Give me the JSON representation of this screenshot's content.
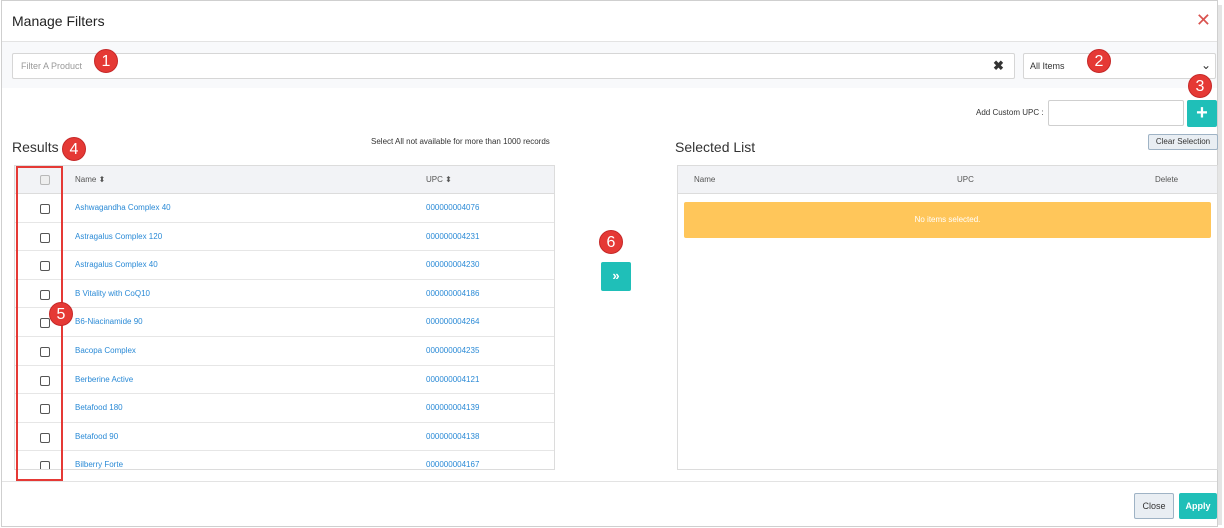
{
  "dialog": {
    "title": "Manage Filters",
    "close_glyph": "✕"
  },
  "filter": {
    "placeholder": "Filter A Product",
    "value": "",
    "clear_glyph": "✖"
  },
  "category_select": {
    "selected": "All Items",
    "chevron_glyph": "⌄"
  },
  "custom_upc": {
    "label": "Add Custom UPC :",
    "value": "",
    "add_glyph": "+"
  },
  "results": {
    "title": "Results",
    "note": "Select All not available for more than 1000 records",
    "columns": {
      "name": "Name ⬍",
      "upc": "UPC ⬍"
    },
    "rows": [
      {
        "name": "Ashwagandha Complex 40",
        "upc": "000000004076"
      },
      {
        "name": "Astragalus Complex 120",
        "upc": "000000004231"
      },
      {
        "name": "Astragalus Complex 40",
        "upc": "000000004230"
      },
      {
        "name": "B Vitality with CoQ10",
        "upc": "000000004186"
      },
      {
        "name": "B6-Niacinamide 90",
        "upc": "000000004264"
      },
      {
        "name": "Bacopa Complex",
        "upc": "000000004235"
      },
      {
        "name": "Berberine Active",
        "upc": "000000004121"
      },
      {
        "name": "Betafood 180",
        "upc": "000000004139"
      },
      {
        "name": "Betafood 90",
        "upc": "000000004138"
      },
      {
        "name": "Bilberry Forte",
        "upc": "000000004167"
      }
    ]
  },
  "move_button": {
    "glyph": "»"
  },
  "selected": {
    "title": "Selected List",
    "clear_label": "Clear Selection",
    "columns": {
      "name": "Name",
      "upc": "UPC",
      "delete": "Delete"
    },
    "empty_message": "No items selected."
  },
  "footer": {
    "close_label": "Close",
    "apply_label": "Apply"
  },
  "markers": [
    "1",
    "2",
    "3",
    "4",
    "5",
    "6"
  ],
  "colors": {
    "accent": "#1fbfb8",
    "link": "#2a8ad6",
    "warning": "#ffc65a",
    "marker": "#e53935"
  }
}
